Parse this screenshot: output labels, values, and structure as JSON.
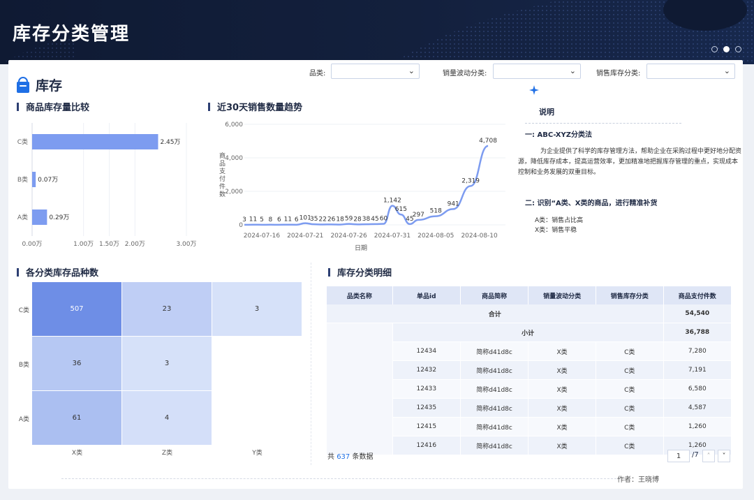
{
  "header": {
    "title": "库存分类管理"
  },
  "section": {
    "title": "库存"
  },
  "filters": [
    {
      "label": "品类:",
      "value": ""
    },
    {
      "label": "销量波动分类:",
      "value": ""
    },
    {
      "label": "销售库存分类:",
      "value": ""
    }
  ],
  "bar_chart": {
    "title": "商品库存量比较",
    "chart_data": {
      "type": "bar",
      "orientation": "horizontal",
      "categories": [
        "C类",
        "B类",
        "A类"
      ],
      "values": [
        24500,
        700,
        2900
      ],
      "value_labels": [
        "2.45万",
        "0.07万",
        "0.29万"
      ],
      "xlim": [
        0,
        30000
      ],
      "ticks": [
        0,
        10000,
        15000,
        20000,
        30000
      ],
      "tick_labels": [
        "0.00万",
        "1.00万",
        "1.50万",
        "2.00万",
        "3.00万"
      ],
      "color": "#7d9cf0"
    }
  },
  "line_chart": {
    "title": "近30天销售数量趋势",
    "chart_data": {
      "type": "line",
      "xlabel": "日期",
      "ylabel": "商品支付件数",
      "ylim": [
        0,
        6000
      ],
      "y_ticks": [
        0,
        2000,
        4000,
        6000
      ],
      "y_tick_labels": [
        "0",
        "2,000",
        "4,000",
        "6,000"
      ],
      "x": [
        "2024-07-14",
        "2024-07-15",
        "2024-07-16",
        "2024-07-17",
        "2024-07-18",
        "2024-07-19",
        "2024-07-20",
        "2024-07-21",
        "2024-07-22",
        "2024-07-23",
        "2024-07-24",
        "2024-07-25",
        "2024-07-26",
        "2024-07-27",
        "2024-07-28",
        "2024-07-29",
        "2024-07-30",
        "2024-07-31",
        "2024-08-01",
        "2024-08-02",
        "2024-08-03",
        "2024-08-04",
        "2024-08-05",
        "2024-08-06",
        "2024-08-07",
        "2024-08-08",
        "2024-08-09",
        "2024-08-10",
        "2024-08-11",
        "2024-08-12",
        "2024-08-13"
      ],
      "values": [
        3,
        11,
        5,
        8,
        6,
        11,
        6,
        101,
        35,
        22,
        26,
        18,
        59,
        28,
        38,
        45,
        60,
        1142,
        615,
        45,
        297,
        null,
        518,
        null,
        941,
        null,
        2319,
        null,
        4708,
        null,
        null
      ],
      "x_tick_labels": [
        "2024-07-16",
        "2024-07-21",
        "2024-07-26",
        "2024-07-31",
        "2024-08-05",
        "2024-08-10"
      ],
      "color": "#7d9cf0"
    }
  },
  "explanation": {
    "title": "说明",
    "heading1": "一: ABC-XYZ分类法",
    "paragraph1": "为企业提供了科学的库存管理方法，帮助企业在采购过程中更好地分配资源，降低库存成本，提高运营效率，更加精准地把握库存管理的重点，实现成本控制和业务发展的双重目标。",
    "heading2": "二: 识别“A类、X类的商品，进行精准补货",
    "note1": "A类：销售占比高",
    "note2": "X类：销售平稳"
  },
  "heatmap": {
    "title": "各分类库存品种数",
    "chart_data": {
      "type": "heatmap",
      "rows": [
        "C类",
        "B类",
        "A类"
      ],
      "cols": [
        "X类",
        "Z类",
        "Y类"
      ],
      "values": [
        [
          507,
          23,
          3
        ],
        [
          36,
          3,
          null
        ],
        [
          61,
          4,
          null
        ]
      ]
    }
  },
  "table": {
    "title": "库存分类明细",
    "columns": [
      "品类名称",
      "单品id",
      "商品简称",
      "销量波动分类",
      "销售库存分类",
      "商品支付件数"
    ],
    "total_label": "合计",
    "total_value": "54,540",
    "subtotal_label": "小计",
    "subtotal_value": "36,788",
    "rows": [
      {
        "id": "12434",
        "name": "简称d41d8c",
        "vol": "X类",
        "stock": "C类",
        "qty": "7,280"
      },
      {
        "id": "12432",
        "name": "简称d41d8c",
        "vol": "X类",
        "stock": "C类",
        "qty": "7,191"
      },
      {
        "id": "12433",
        "name": "简称d41d8c",
        "vol": "X类",
        "stock": "C类",
        "qty": "6,580"
      },
      {
        "id": "12435",
        "name": "简称d41d8c",
        "vol": "X类",
        "stock": "C类",
        "qty": "4,587"
      },
      {
        "id": "12415",
        "name": "简称d41d8c",
        "vol": "X类",
        "stock": "C类",
        "qty": "1,260"
      },
      {
        "id": "12416",
        "name": "简称d41d8c",
        "vol": "X类",
        "stock": "C类",
        "qty": "1,260"
      }
    ],
    "footer_prefix": "共",
    "footer_count": "637",
    "footer_suffix": "条数据",
    "page_current": "1",
    "page_total": "/7"
  },
  "footer": {
    "author": "作者：王晓博"
  },
  "colors": {
    "accent": "#7d9cf0",
    "heat_high": "#6e8ee6",
    "heat_low": "#dbe5fa",
    "brand": "#1f6fe5"
  }
}
